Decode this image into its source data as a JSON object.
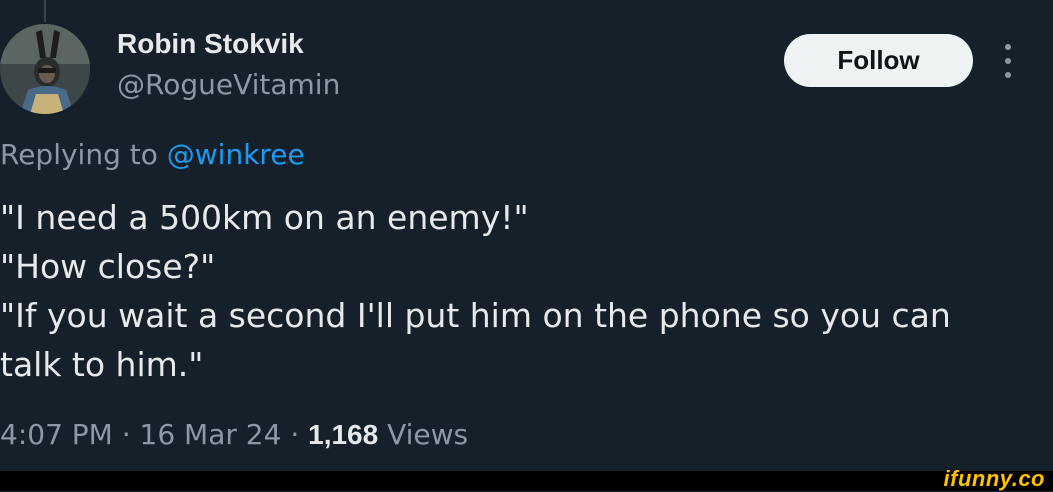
{
  "author": {
    "name": "Robin Stokvik",
    "handle": "@RogueVitamin"
  },
  "actions": {
    "follow_label": "Follow",
    "more_icon": "more-vertical-icon"
  },
  "reply": {
    "prefix": "Replying to ",
    "mention": "@winkree"
  },
  "tweet": {
    "lines": [
      "\"I need a 500km on an enemy!\"",
      "\"How close?\"",
      "\"If you wait a second I'll put him on the phone so you can",
      "talk to him.\""
    ]
  },
  "meta": {
    "time": "4:07 PM",
    "sep1": " · ",
    "date": "16 Mar 24",
    "sep2": " · ",
    "views_count": "1,168",
    "views_label": " Views"
  },
  "watermark": "ifunny.co",
  "colors": {
    "background": "#15202b",
    "text_primary": "#e7e9ea",
    "text_secondary": "#8b98a5",
    "link": "#1d9bf0",
    "watermark": "#ffc200"
  }
}
